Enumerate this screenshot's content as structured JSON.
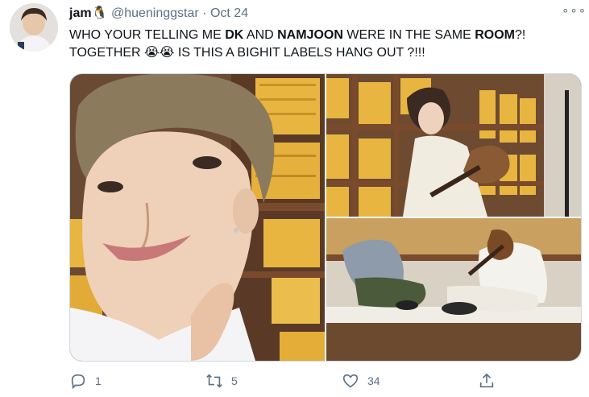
{
  "tweet": {
    "author_name": "jam",
    "author_emoji": "🐧",
    "handle": "@hueninggstar",
    "separator": "·",
    "time": "Oct 24",
    "line1_a": "WHO YOUR TELLING ME ",
    "line1_b": "DK",
    "line1_c": " AND ",
    "line1_d": "NAMJOON",
    "line1_e": " WERE IN THE SAME ",
    "line1_f": "ROOM",
    "line1_g": "?!",
    "line2_a": "TOGETHER ",
    "line2_emoji": "😭😭",
    "line2_b": " IS THIS A BIGHIT LABELS HANG OUT ?!!!"
  },
  "more_label": "∘∘∘",
  "actions": {
    "reply_count": "1",
    "retweet_count": "5",
    "like_count": "34"
  },
  "colors": {
    "text": "#0f1419",
    "secondary": "#5b7083",
    "border": "#cfd9de",
    "shelf_wood": "#7a4a2c",
    "binder_yellow": "#e8b640"
  }
}
